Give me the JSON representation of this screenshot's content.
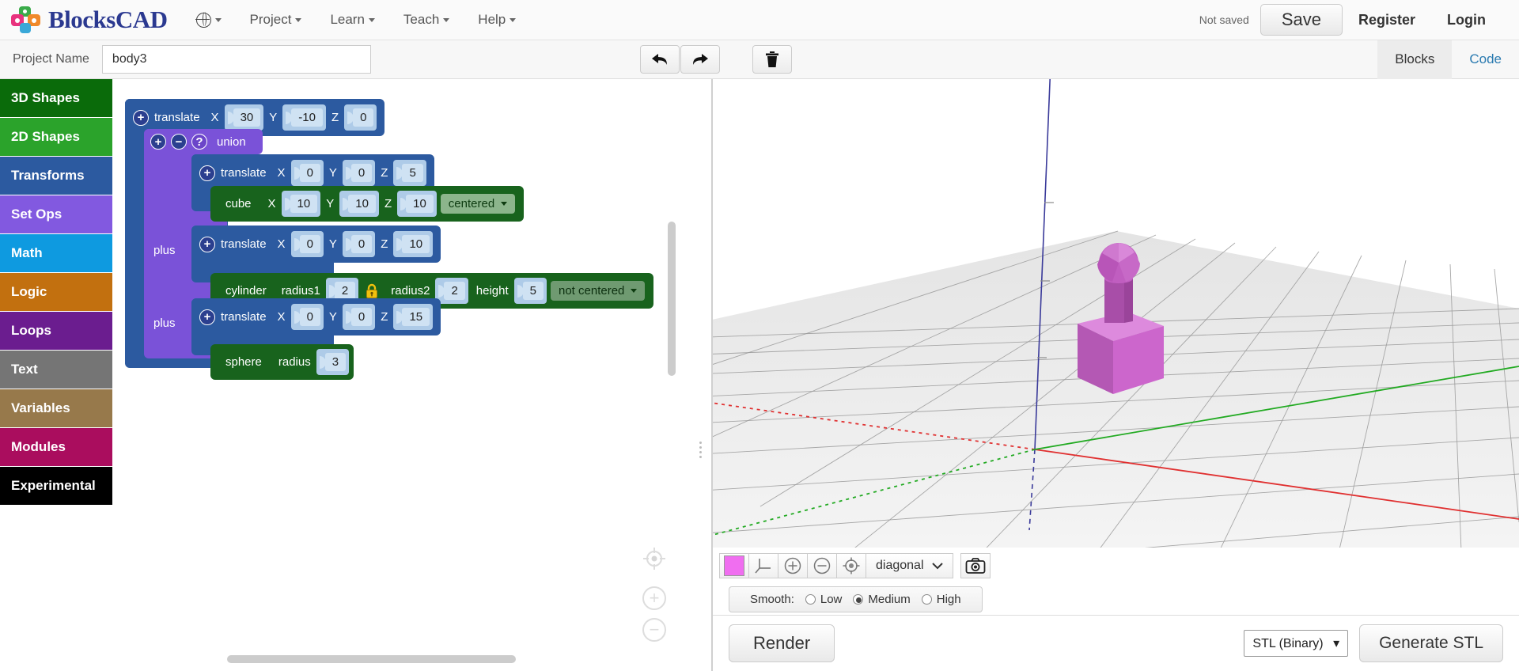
{
  "app": {
    "brand": "BlocksCAD"
  },
  "topnav": {
    "globe_icon": "globe-icon",
    "items": [
      {
        "label": "Project",
        "icon": "chevron-down-icon"
      },
      {
        "label": "Learn",
        "icon": "chevron-down-icon"
      },
      {
        "label": "Teach",
        "icon": "chevron-down-icon"
      },
      {
        "label": "Help",
        "icon": "chevron-down-icon"
      }
    ],
    "save_status": "Not saved",
    "save_label": "Save",
    "register_label": "Register",
    "login_label": "Login"
  },
  "projectbar": {
    "name_label": "Project Name",
    "name_value": "body3",
    "name_placeholder": "Project Name",
    "undo_icon": "undo-arrow-icon",
    "redo_icon": "redo-arrow-icon",
    "delete_icon": "trash-icon",
    "tabs": [
      {
        "label": "Blocks",
        "active": true
      },
      {
        "label": "Code",
        "active": false
      }
    ]
  },
  "sidebar": {
    "items": [
      {
        "label": "3D Shapes",
        "color": "#0a6b0a"
      },
      {
        "label": "2D Shapes",
        "color": "#2ba32b"
      },
      {
        "label": "Transforms",
        "color": "#2c5aa0"
      },
      {
        "label": "Set Ops",
        "color": "#8259e0"
      },
      {
        "label": "Math",
        "color": "#0e9ae0"
      },
      {
        "label": "Logic",
        "color": "#c2700f"
      },
      {
        "label": "Loops",
        "color": "#6b1d8f"
      },
      {
        "label": "Text",
        "color": "#757575"
      },
      {
        "label": "Variables",
        "color": "#97794b"
      },
      {
        "label": "Modules",
        "color": "#aa0d5e"
      },
      {
        "label": "Experimental",
        "color": "#000000"
      }
    ]
  },
  "workspace": {
    "zoom_in_label": "+",
    "zoom_out_label": "−",
    "center_icon": "center-target-icon",
    "blocks": {
      "root_translate": {
        "name": "translate",
        "x_label": "X",
        "x_value": "30",
        "y_label": "Y",
        "y_value": "-10",
        "z_label": "Z",
        "z_value": "0",
        "expand_icon": "plus-icon"
      },
      "union": {
        "name": "union",
        "expand_icon": "plus-icon",
        "collapse_icon": "minus-icon",
        "help_icon": "question-icon",
        "slot_labels": [
          "plus",
          "plus"
        ]
      },
      "child1_translate": {
        "name": "translate",
        "x_label": "X",
        "x_value": "0",
        "y_label": "Y",
        "y_value": "0",
        "z_label": "Z",
        "z_value": "5",
        "expand_icon": "plus-icon"
      },
      "cube": {
        "name": "cube",
        "x_label": "X",
        "x_value": "10",
        "y_label": "Y",
        "y_value": "10",
        "z_label": "Z",
        "z_value": "10",
        "centered_value": "centered"
      },
      "child2_translate": {
        "name": "translate",
        "x_label": "X",
        "x_value": "0",
        "y_label": "Y",
        "y_value": "0",
        "z_label": "Z",
        "z_value": "10",
        "expand_icon": "plus-icon"
      },
      "cylinder": {
        "name": "cylinder",
        "radius1_label": "radius1",
        "radius1_value": "2",
        "lock_icon": "lock-icon",
        "radius2_label": "radius2",
        "radius2_value": "2",
        "height_label": "height",
        "height_value": "5",
        "centered_value": "not centered"
      },
      "child3_translate": {
        "name": "translate",
        "x_label": "X",
        "x_value": "0",
        "y_label": "Y",
        "y_value": "0",
        "z_label": "Z",
        "z_value": "15",
        "expand_icon": "plus-icon"
      },
      "sphere": {
        "name": "sphere",
        "radius_label": "radius",
        "radius_value": "3"
      }
    }
  },
  "viewer": {
    "object_color": "#cc66cc",
    "axis_x_color": "#e03030",
    "axis_y_color": "#22aa22",
    "axis_z_color": "#3a3a9a",
    "toolbar": {
      "color_swatch": "#f06ef0",
      "axes_icon": "axes-icon",
      "zoom_in_icon": "zoom-in-icon",
      "zoom_out_icon": "zoom-out-icon",
      "center_icon": "center-view-icon",
      "view_select_value": "diagonal",
      "camera_icon": "camera-icon"
    },
    "smooth": {
      "label": "Smooth:",
      "options": [
        {
          "label": "Low",
          "selected": false
        },
        {
          "label": "Medium",
          "selected": true
        },
        {
          "label": "High",
          "selected": false
        }
      ]
    },
    "render_label": "Render",
    "stl_format_value": "STL (Binary)",
    "generate_label": "Generate STL"
  }
}
